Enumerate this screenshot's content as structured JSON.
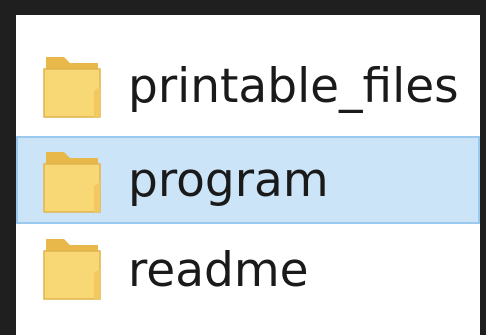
{
  "explorer": {
    "items": [
      {
        "name": "printable_files",
        "type": "folder",
        "selected": false
      },
      {
        "name": "program",
        "type": "folder",
        "selected": true
      },
      {
        "name": "readme",
        "type": "folder",
        "selected": false
      }
    ]
  },
  "colors": {
    "background": "#1f1f1f",
    "pane": "#ffffff",
    "selection_fill": "#cce4f7",
    "selection_border": "#99c9ef",
    "folder_body": "#f8d775",
    "folder_back": "#e8b84a",
    "text": "#1a1a1a"
  },
  "icons": {
    "item_icon": "folder-icon"
  }
}
